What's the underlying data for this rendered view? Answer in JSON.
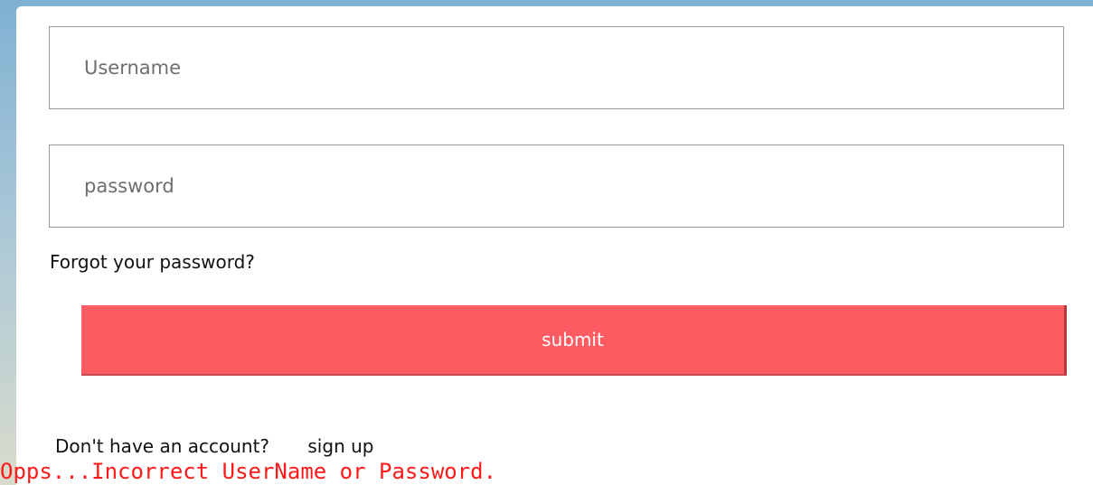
{
  "login_form": {
    "username_placeholder": "Username",
    "password_placeholder": "password",
    "forgot_password_label": "Forgot your password?",
    "submit_label": "submit",
    "no_account_text": "Don't have an account?",
    "signup_label": "sign up"
  },
  "error_message": "Opps...Incorrect UserName or Password.",
  "colors": {
    "submit_background": "#fe5b62",
    "error_text": "#ff1a1a"
  }
}
